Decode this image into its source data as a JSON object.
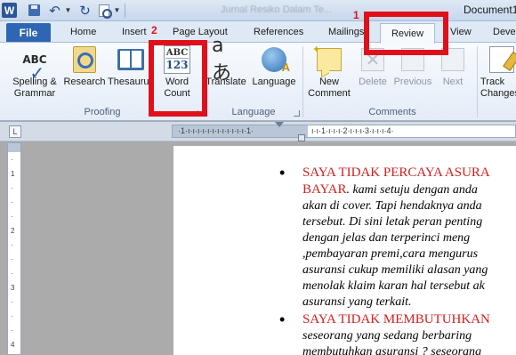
{
  "titlebar": {
    "blurred_title": "Jurnal Resiko Dalam Te...",
    "document_title": "Document1"
  },
  "tabs": {
    "file": "File",
    "home": "Home",
    "insert": "Insert",
    "page_layout": "Page Layout",
    "references": "References",
    "mailings": "Mailings",
    "review": "Review",
    "view": "View",
    "developer": "Develo"
  },
  "ribbon": {
    "proofing": {
      "group_label": "Proofing",
      "spelling": "Spelling &\nGrammar",
      "research": "Research",
      "thesaurus": "Thesaurus",
      "word_count": "Word\nCount"
    },
    "language": {
      "group_label": "Language",
      "translate": "Translate",
      "language": "Language"
    },
    "comments": {
      "group_label": "Comments",
      "new_comment": "New\nComment",
      "delete": "Delete",
      "previous": "Previous",
      "next": "Next"
    },
    "tracking": {
      "track_changes": "Track\nChanges"
    }
  },
  "annotations": {
    "step1": "1",
    "step2": "2",
    "highlight_color": "#e0101a"
  },
  "document": {
    "bullet1": {
      "heading_line1": "SAYA TIDAK PERCAYA ASURA",
      "heading_line2": "BAYAR",
      "line2_rest": ". kami setuju dengan anda",
      "lines": [
        "akan di cover. Tapi hendaknya anda",
        "tersebut. Di sini letak peran penting",
        "dengan jelas dan terperinci meng",
        ",pembayaran premi,cara mengurus",
        "asuransi cukup memiliki alasan yang",
        "menolak klaim karan hal tersebut ak",
        "asuransi yang terkait."
      ]
    },
    "bullet2": {
      "heading": "SAYA TIDAK MEMBUTUHKAN",
      "lines": [
        "seseorang yang sedang berbaring",
        "membutuhkan asuransi ? seseorang"
      ]
    }
  }
}
